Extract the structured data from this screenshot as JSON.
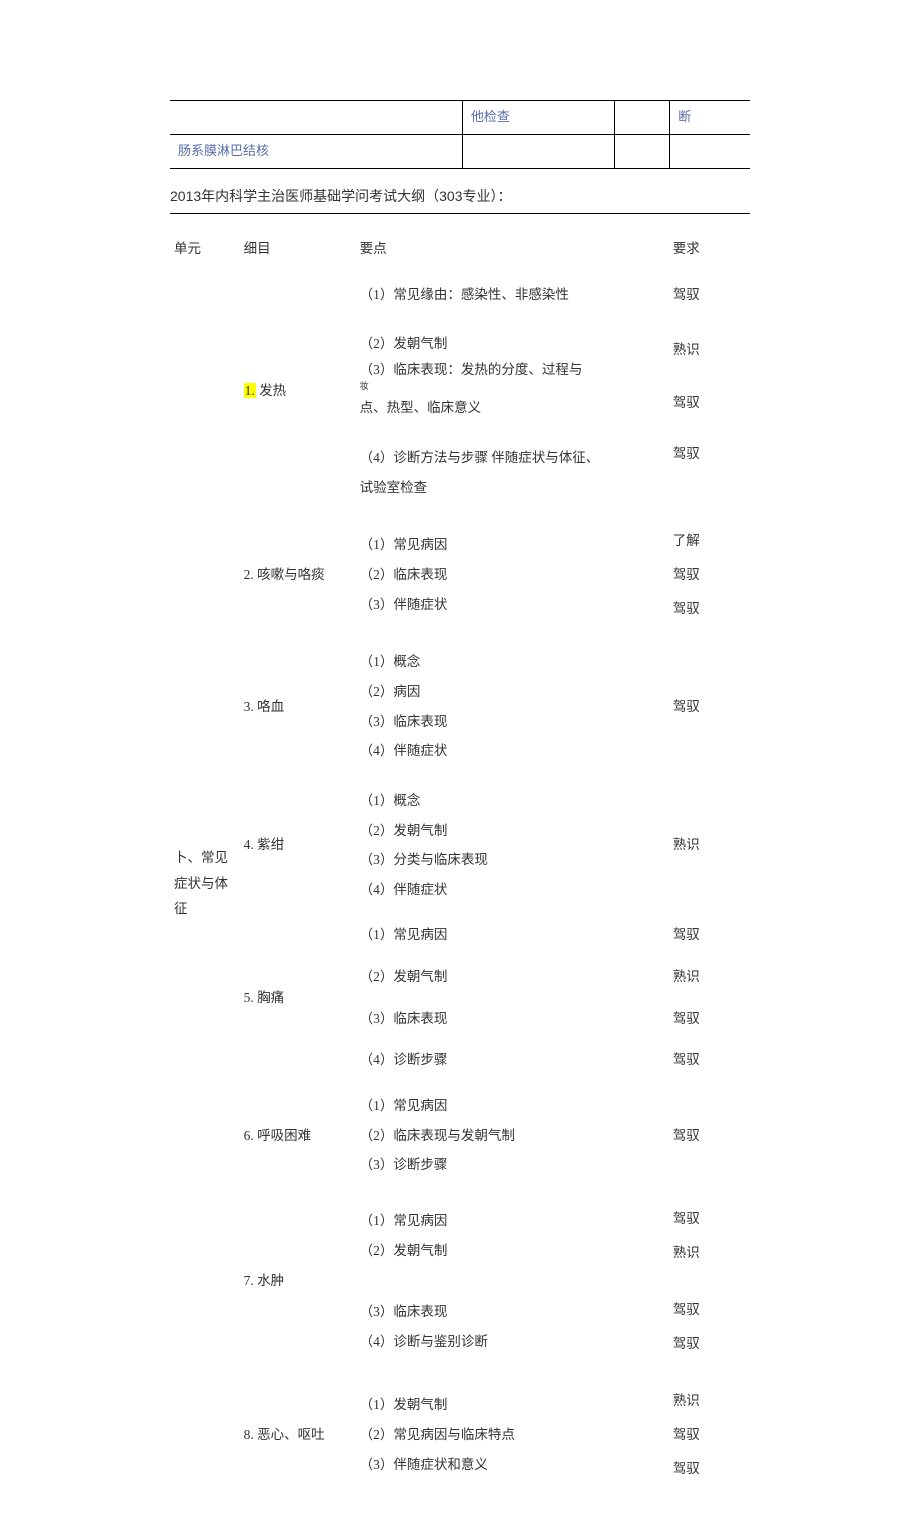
{
  "top_table": {
    "r1c2": "他检查",
    "r1c3": "断",
    "r2c1": "肠系膜淋巴结核"
  },
  "heading": "2013年内科学主治医师基础学问考试大纲（303专业）：",
  "header": {
    "unit": "单元",
    "item": "细目",
    "point": "要点",
    "req": "要求"
  },
  "unit_label": "卜、常见症状与体征",
  "items": {
    "i1_num": "1.",
    "i1_label": " 发热",
    "i2": "2. 咳嗽与咯痰",
    "i3": "3. 咯血",
    "i4": "4. 紫绀",
    "i5": "5. 胸痛",
    "i6": "6. 呼吸困难",
    "i7": "7. 水肿",
    "i8": "8. 恶心、呕吐"
  },
  "pts": {
    "p1_1": "（1）常见缘由：感染性、非感染性",
    "p1_2": "（2）发朝气制",
    "p1_3a": "（3）临床表现：发热的分度、过程与",
    "p1_3note": "妆",
    "p1_3b": "点、热型、临床意义",
    "p1_4a": "（4）诊断方法与步骤 伴随症状与体征、",
    "p1_4b": "试验室检查",
    "p2_1": "（1）常见病因",
    "p2_2": "（2）临床表现",
    "p2_3": "（3）伴随症状",
    "p3_1": "（1）概念",
    "p3_2": "（2）病因",
    "p3_3": "（3）临床表现",
    "p3_4": "（4）伴随症状",
    "p4_1": "（1）概念",
    "p4_2": "（2）发朝气制",
    "p4_3": "（3）分类与临床表现",
    "p4_4": "（4）伴随症状",
    "p5_1": "（1）常见病因",
    "p5_2": "（2）发朝气制",
    "p5_3": "（3）临床表现",
    "p5_4": "（4）诊断步骤",
    "p6_1": "（1）常见病因",
    "p6_2": "（2）临床表现与发朝气制",
    "p6_3": "（3）诊断步骤",
    "p7_1": "（1）常见病因",
    "p7_2": "（2）发朝气制",
    "p7_3": "（3）临床表现",
    "p7_4": "（4）诊断与鉴别诊断",
    "p8_1": "（1）发朝气制",
    "p8_2": "（2）常见病因与临床特点",
    "p8_3": "（3）伴随症状和意义"
  },
  "req": {
    "jy": "驾驭",
    "sx": "熟识",
    "lj": "了解"
  }
}
